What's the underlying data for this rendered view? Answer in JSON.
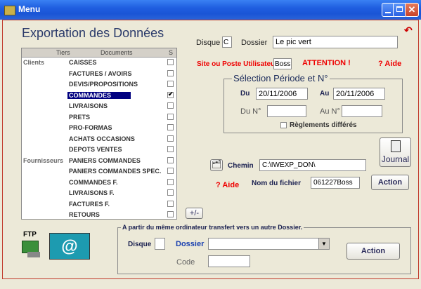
{
  "window": {
    "title": "Menu"
  },
  "heading": "Exportation des Données",
  "disque": {
    "label": "Disque",
    "value": "C"
  },
  "dossier": {
    "label": "Dossier",
    "value": "Le pic vert"
  },
  "site": {
    "label": "Site ou Poste Utilisateur",
    "value": "Boss",
    "warning": "ATTENTION !",
    "help": "? Aide"
  },
  "periode": {
    "title": "Sélection Période et N°",
    "du_label": "Du",
    "du_value": "20/11/2006",
    "au_label": "Au",
    "au_value": "20/11/2006",
    "du_n_label": "Du N°",
    "au_n_label": "Au N°",
    "reglements_label": "Règlements différés"
  },
  "table": {
    "headers": {
      "tiers": "Tiers",
      "documents": "Documents",
      "s": "S"
    },
    "rows": [
      {
        "group": "Clients",
        "doc": "CAISSES",
        "checked": false
      },
      {
        "group": "",
        "doc": "FACTURES / AVOIRS",
        "checked": false
      },
      {
        "group": "",
        "doc": "DEVIS/PROPOSITIONS",
        "checked": false
      },
      {
        "group": "",
        "doc": "COMMANDES",
        "checked": true
      },
      {
        "group": "",
        "doc": "LIVRAISONS",
        "checked": false
      },
      {
        "group": "",
        "doc": "PRETS",
        "checked": false
      },
      {
        "group": "",
        "doc": "PRO-FORMAS",
        "checked": false
      },
      {
        "group": "",
        "doc": "ACHATS OCCASIONS",
        "checked": false
      },
      {
        "group": "",
        "doc": "DEPOTS VENTES",
        "checked": false
      },
      {
        "group": "Fournisseurs",
        "doc": "PANIERS COMMANDES",
        "checked": false
      },
      {
        "group": "",
        "doc": "PANIERS COMMANDES SPEC.",
        "checked": false
      },
      {
        "group": "",
        "doc": "COMMANDES F.",
        "checked": false
      },
      {
        "group": "",
        "doc": "LIVRAISONS F.",
        "checked": false
      },
      {
        "group": "",
        "doc": "FACTURES F.",
        "checked": false
      },
      {
        "group": "",
        "doc": "RETOURS",
        "checked": false
      }
    ]
  },
  "toggle_all": "+/-",
  "chemin": {
    "label": "Chemin",
    "value": "C:\\IWEXP_DON\\"
  },
  "fichier": {
    "help": "? Aide",
    "label": "Nom du fichier",
    "value": "061227Boss"
  },
  "journal_label": "Journal",
  "action_label": "Action",
  "transfer": {
    "title": "A partir du même ordinateur transfert vers un autre Dossier.",
    "disque_label": "Disque",
    "dossier_label": "Dossier",
    "code_label": "Code",
    "action_label": "Action"
  },
  "ftp_label": "FTP",
  "colors": {
    "titlebar": "#1f5ee0",
    "selection": "#000080",
    "warning": "#ee0000"
  }
}
